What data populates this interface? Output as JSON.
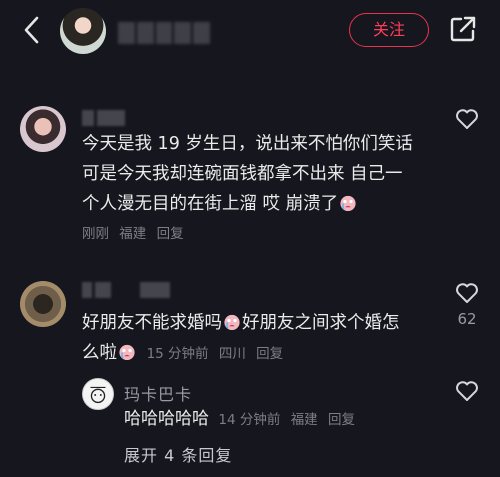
{
  "header": {
    "follow_label": "关注"
  },
  "comments": [
    {
      "text_line1": "今天是我 19 岁生日，说出来不怕你们笑话",
      "text_line2": "可是今天我却连碗面钱都拿不出来 自己一",
      "text_line3": "个人漫无目的在街上溜 哎 崩溃了",
      "time": "刚刚",
      "location": "福建",
      "reply_label": "回复"
    },
    {
      "text_line1_a": "好朋友不能求婚吗",
      "text_line1_b": "好朋友之间求个婚怎",
      "text_line2": "么啦",
      "time": "15 分钟前",
      "location": "四川",
      "reply_label": "回复",
      "like_count": "62"
    }
  ],
  "reply": {
    "name": "玛卡巴卡",
    "text": "哈哈哈哈哈",
    "time": "14 分钟前",
    "location": "福建",
    "reply_label": "回复"
  },
  "expand_label": "展开 4 条回复",
  "icons": {
    "back": "chevron-left-icon",
    "share": "share-icon",
    "like": "heart-outline-icon",
    "emoji": "crying-face-emoji"
  },
  "colors": {
    "background": "#16161e",
    "accent": "#e8334e",
    "text": "#ebebeb",
    "meta": "#7d7d85"
  }
}
